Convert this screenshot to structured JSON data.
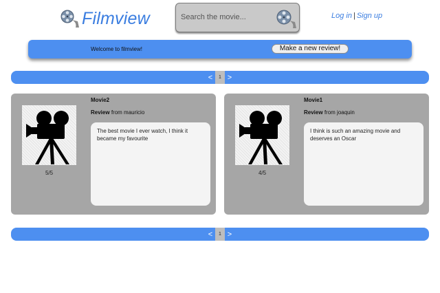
{
  "brand": {
    "name": "Filmview",
    "icon": "film-reel-icon",
    "color": "#3a7de0"
  },
  "search": {
    "placeholder": "Search the movie...",
    "value": "",
    "icon": "film-reel-icon"
  },
  "auth": {
    "login_label": "Log in",
    "separator": "|",
    "signup_label": "Sign up"
  },
  "welcome": {
    "text": "Welcome to filmview!",
    "button_label": "Make a new review!"
  },
  "pagination": {
    "prev": "<",
    "current": "1",
    "next": ">"
  },
  "reviews": [
    {
      "title": "Movie2",
      "review_label": "Review",
      "author_prefix": "from",
      "author": "mauricio",
      "rating": "5/5",
      "text": "The best movie I ever watch, I think it became my favourite",
      "poster_icon": "movie-camera-icon"
    },
    {
      "title": "Movie1",
      "review_label": "Review",
      "author_prefix": "from",
      "author": "joaquin",
      "rating": "4/5",
      "text": "I think is such an amazing movie and deserves an Oscar",
      "poster_icon": "movie-camera-icon"
    }
  ],
  "colors": {
    "accent": "#4d8ff0",
    "card_bg": "#a6a6a6",
    "review_bg": "#f4f4f4"
  }
}
